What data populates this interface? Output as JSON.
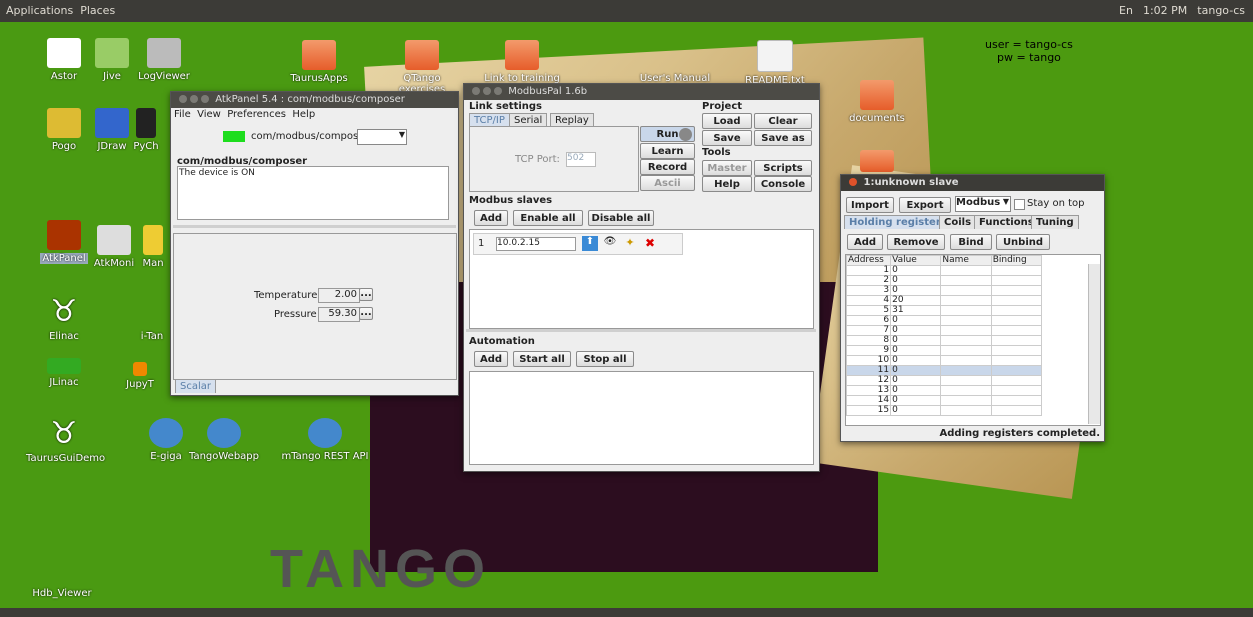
{
  "topbar": {
    "applications": "Applications",
    "places": "Places",
    "time": "1:02 PM",
    "user": "tango-cs",
    "lang": "En"
  },
  "note": {
    "line1": "user = tango-cs",
    "line2": "pw = tango"
  },
  "desktop_icons": [
    "Astor",
    "Jive",
    "LogViewer",
    "Pogo",
    "JDraw",
    "PyCh",
    "AtkPanel",
    "AtkMoni",
    "Man",
    "Elinac",
    "i-Tan",
    "JLinac",
    "JupyT",
    "TaurusGuiDemo",
    "E-giga",
    "TangoWebapp",
    "mTango REST API",
    "Hdb_Viewer",
    "TaurusApps",
    "QTango exercises",
    "Link to training",
    "User's Manual",
    "README.txt",
    "documents"
  ],
  "atkpanel": {
    "title": "AtkPanel 5.4 : com/modbus/composer",
    "menu": [
      "File",
      "View",
      "Preferences",
      "Help"
    ],
    "device": "com/modbus/composer",
    "group": "com/modbus/composer",
    "status": "The device is ON",
    "temp_label": "Temperature",
    "temp_value": "2.00",
    "pressure_label": "Pressure",
    "pressure_value": "59.30",
    "tab": "Scalar",
    "more": "..."
  },
  "modbuspal": {
    "title": "ModbusPal 1.6b",
    "link_settings": "Link settings",
    "tabs": [
      "TCP/IP",
      "Serial",
      "Replay"
    ],
    "tcp_port_label": "TCP Port:",
    "tcp_port": "502",
    "run": "Run",
    "learn": "Learn",
    "record": "Record",
    "ascii": "Ascii",
    "project": "Project",
    "load": "Load",
    "clear": "Clear",
    "save": "Save",
    "save_as": "Save as",
    "tools": "Tools",
    "master": "Master",
    "scripts": "Scripts",
    "help": "Help",
    "console": "Console",
    "slaves": "Modbus slaves",
    "add": "Add",
    "enable_all": "Enable all",
    "disable_all": "Disable all",
    "slave_id": "1",
    "slave_ip": "10.0.2.15",
    "automation": "Automation",
    "start_all": "Start all",
    "stop_all": "Stop all"
  },
  "slave": {
    "title": "1:unknown slave",
    "import": "Import",
    "export": "Export",
    "protocol": "Modbus",
    "stay_on_top": "Stay on top",
    "tabs": [
      "Holding registers",
      "Coils",
      "Functions",
      "Tuning"
    ],
    "add": "Add",
    "remove": "Remove",
    "bind": "Bind",
    "unbind": "Unbind",
    "columns": [
      "Address",
      "Value",
      "Name",
      "Binding"
    ],
    "rows": [
      [
        "1",
        "0"
      ],
      [
        "2",
        "0"
      ],
      [
        "3",
        "0"
      ],
      [
        "4",
        "20"
      ],
      [
        "5",
        "31"
      ],
      [
        "6",
        "0"
      ],
      [
        "7",
        "0"
      ],
      [
        "8",
        "0"
      ],
      [
        "9",
        "0"
      ],
      [
        "10",
        "0"
      ],
      [
        "11",
        "0"
      ],
      [
        "12",
        "0"
      ],
      [
        "13",
        "0"
      ],
      [
        "14",
        "0"
      ],
      [
        "15",
        "0"
      ]
    ],
    "status": "Adding registers completed."
  },
  "logo": "TANGO"
}
